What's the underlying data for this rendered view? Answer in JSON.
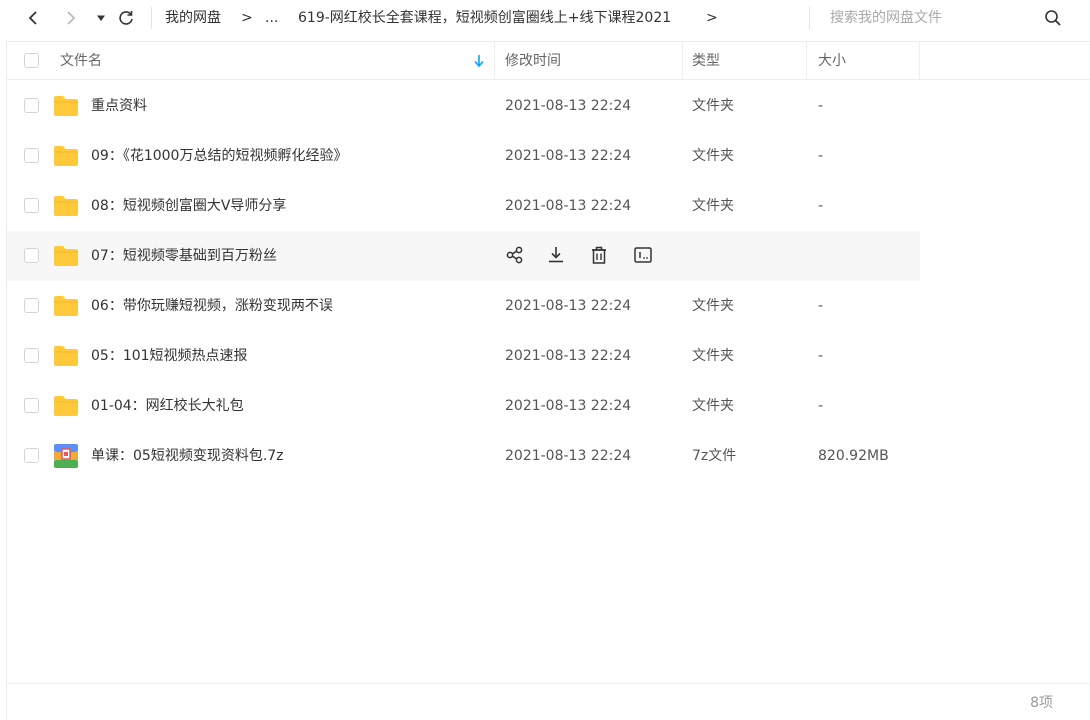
{
  "nav": {
    "breadcrumb": [
      "我的网盘",
      "...",
      "619-网红校长全套课程，短视频创富圈线上+线下课程2021"
    ],
    "separator": ">"
  },
  "search": {
    "placeholder": "搜索我的网盘文件"
  },
  "columns": {
    "name": "文件名",
    "modified": "修改时间",
    "type": "类型",
    "size": "大小"
  },
  "files": [
    {
      "name": "重点资料",
      "date": "2021-08-13 22:24",
      "type": "文件夹",
      "size": "-",
      "icon": "folder-icon"
    },
    {
      "name": "09：《花1000万总结的短视频孵化经验》",
      "date": "2021-08-13 22:24",
      "type": "文件夹",
      "size": "-",
      "icon": "folder-icon"
    },
    {
      "name": "08：短视频创富圈大V导师分享",
      "date": "2021-08-13 22:24",
      "type": "文件夹",
      "size": "-",
      "icon": "folder-icon"
    },
    {
      "name": "07：短视频零基础到百万粉丝",
      "date": "",
      "type": "",
      "size": "",
      "icon": "folder-icon",
      "hovered": true
    },
    {
      "name": "06：带你玩赚短视频，涨粉变现两不误",
      "date": "2021-08-13 22:24",
      "type": "文件夹",
      "size": "-",
      "icon": "folder-icon"
    },
    {
      "name": "05：101短视频热点速报",
      "date": "2021-08-13 22:24",
      "type": "文件夹",
      "size": "-",
      "icon": "folder-icon"
    },
    {
      "name": "01-04：网红校长大礼包",
      "date": "2021-08-13 22:24",
      "type": "文件夹",
      "size": "-",
      "icon": "folder-icon"
    },
    {
      "name": "单课：05短视频变现资料包.7z",
      "date": "2021-08-13 22:24",
      "type": "7z文件",
      "size": "820.92MB",
      "icon": "archive-icon"
    }
  ],
  "row_actions": [
    "share-icon",
    "download-icon",
    "delete-icon",
    "rename-icon"
  ],
  "footer": {
    "count": "8项"
  },
  "colors": {
    "folder": "#FFC93C",
    "accent": "#06A7FF",
    "hover_row": "#F7F7F7"
  }
}
